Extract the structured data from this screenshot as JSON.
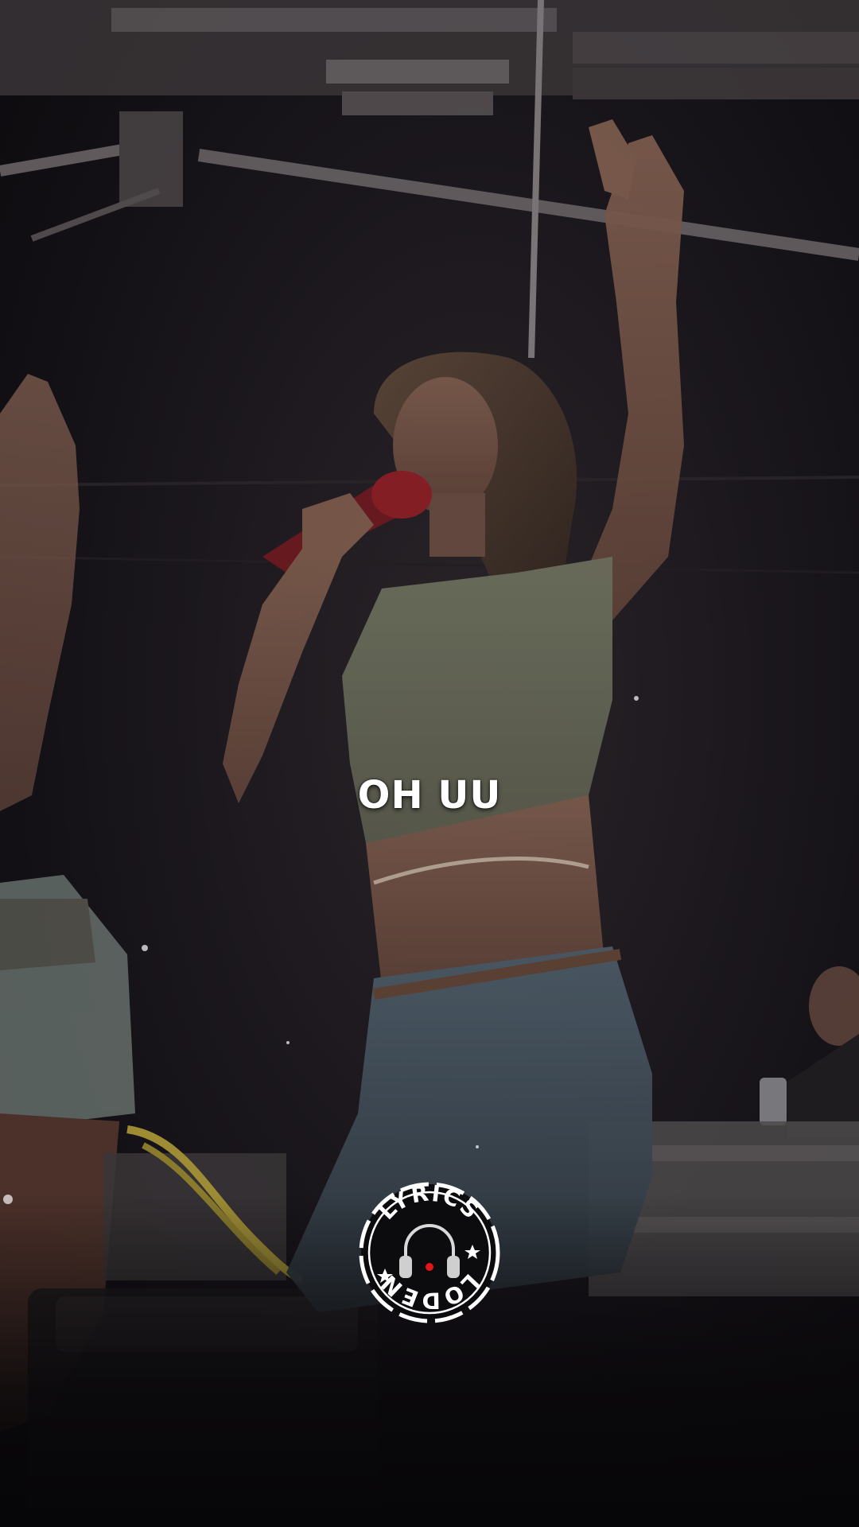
{
  "lyric": {
    "text": "OH UU"
  },
  "watermark": {
    "text_top": "LYRICS",
    "text_bottom": "LODEN",
    "icon": "headphones-icon",
    "accent_color": "#e0161b"
  },
  "scene": {
    "description_icons": [
      "stage-truss",
      "performer",
      "microphone",
      "speaker",
      "dancer"
    ]
  }
}
